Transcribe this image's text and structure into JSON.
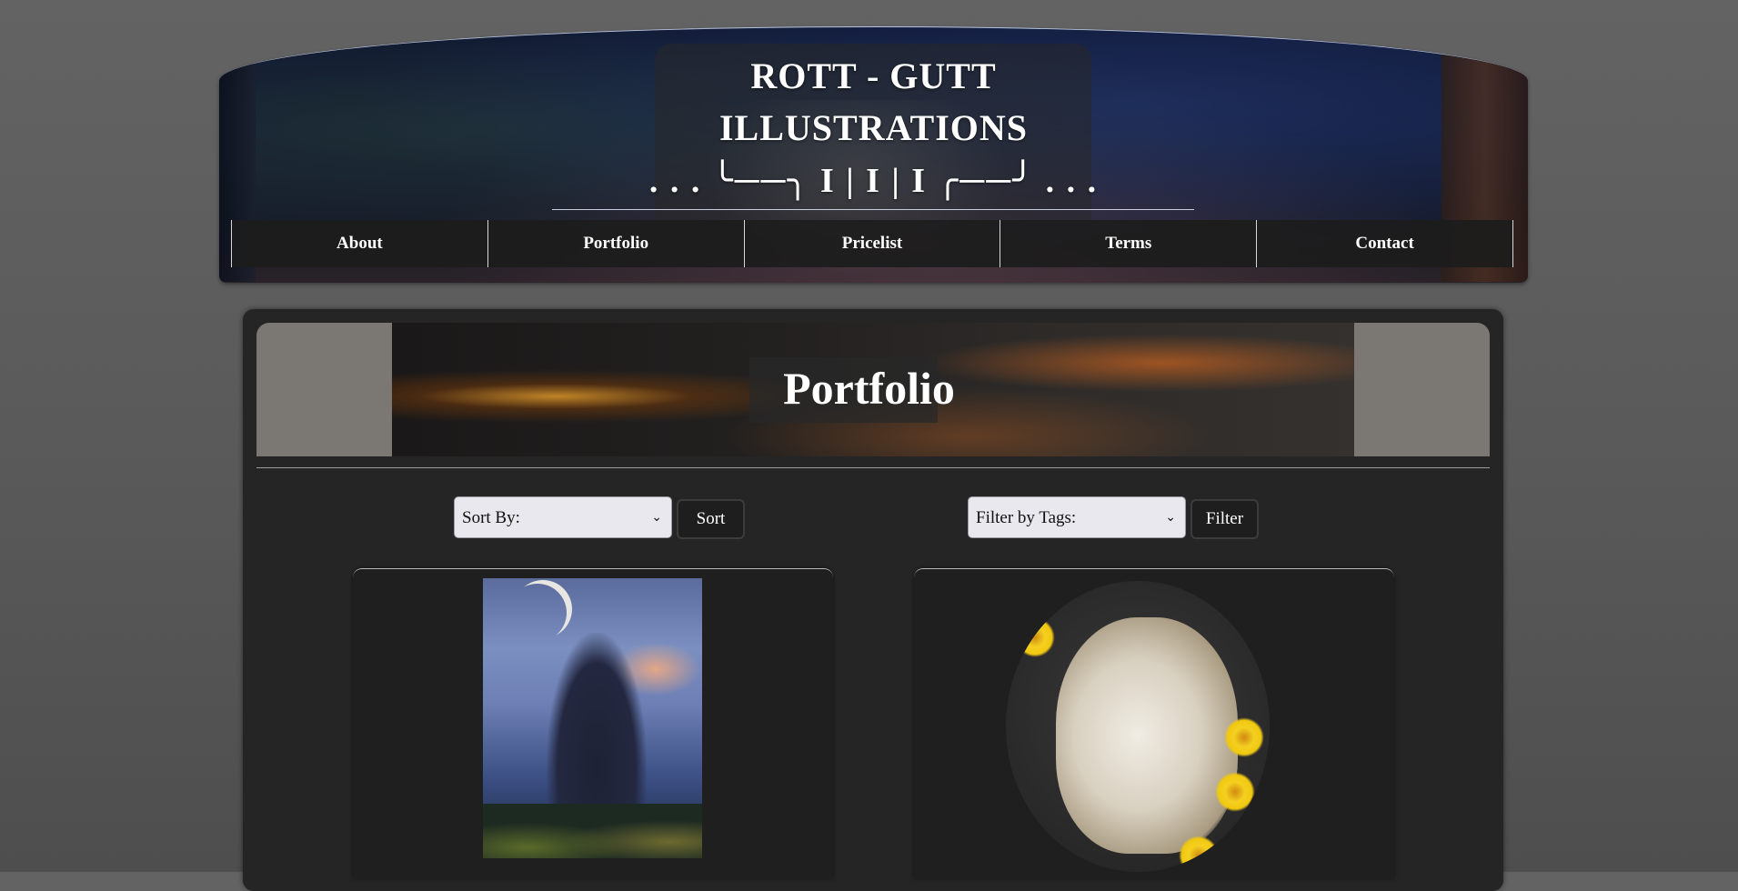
{
  "header": {
    "title_line1": "ROTT - GUTT",
    "title_line2": "ILLUSTRATIONS",
    "title_line3": ". . . ╰──╮ I | I | I ╭──╯ . . ."
  },
  "nav": {
    "items": [
      {
        "label": "About"
      },
      {
        "label": "Portfolio"
      },
      {
        "label": "Pricelist"
      },
      {
        "label": "Terms"
      },
      {
        "label": "Contact"
      }
    ]
  },
  "main": {
    "banner_title": "Portfolio",
    "sort": {
      "selected": "Sort By:",
      "button_label": "Sort"
    },
    "filter": {
      "selected": "Filter by Tags:",
      "button_label": "Filter"
    }
  },
  "icons": {
    "select_chevron": "chevron-down-icon"
  },
  "colors": {
    "page_bg": "#5e5e5e",
    "panel_bg": "#252525",
    "nav_bg": "#1c1c1c",
    "text": "#ffffff"
  }
}
